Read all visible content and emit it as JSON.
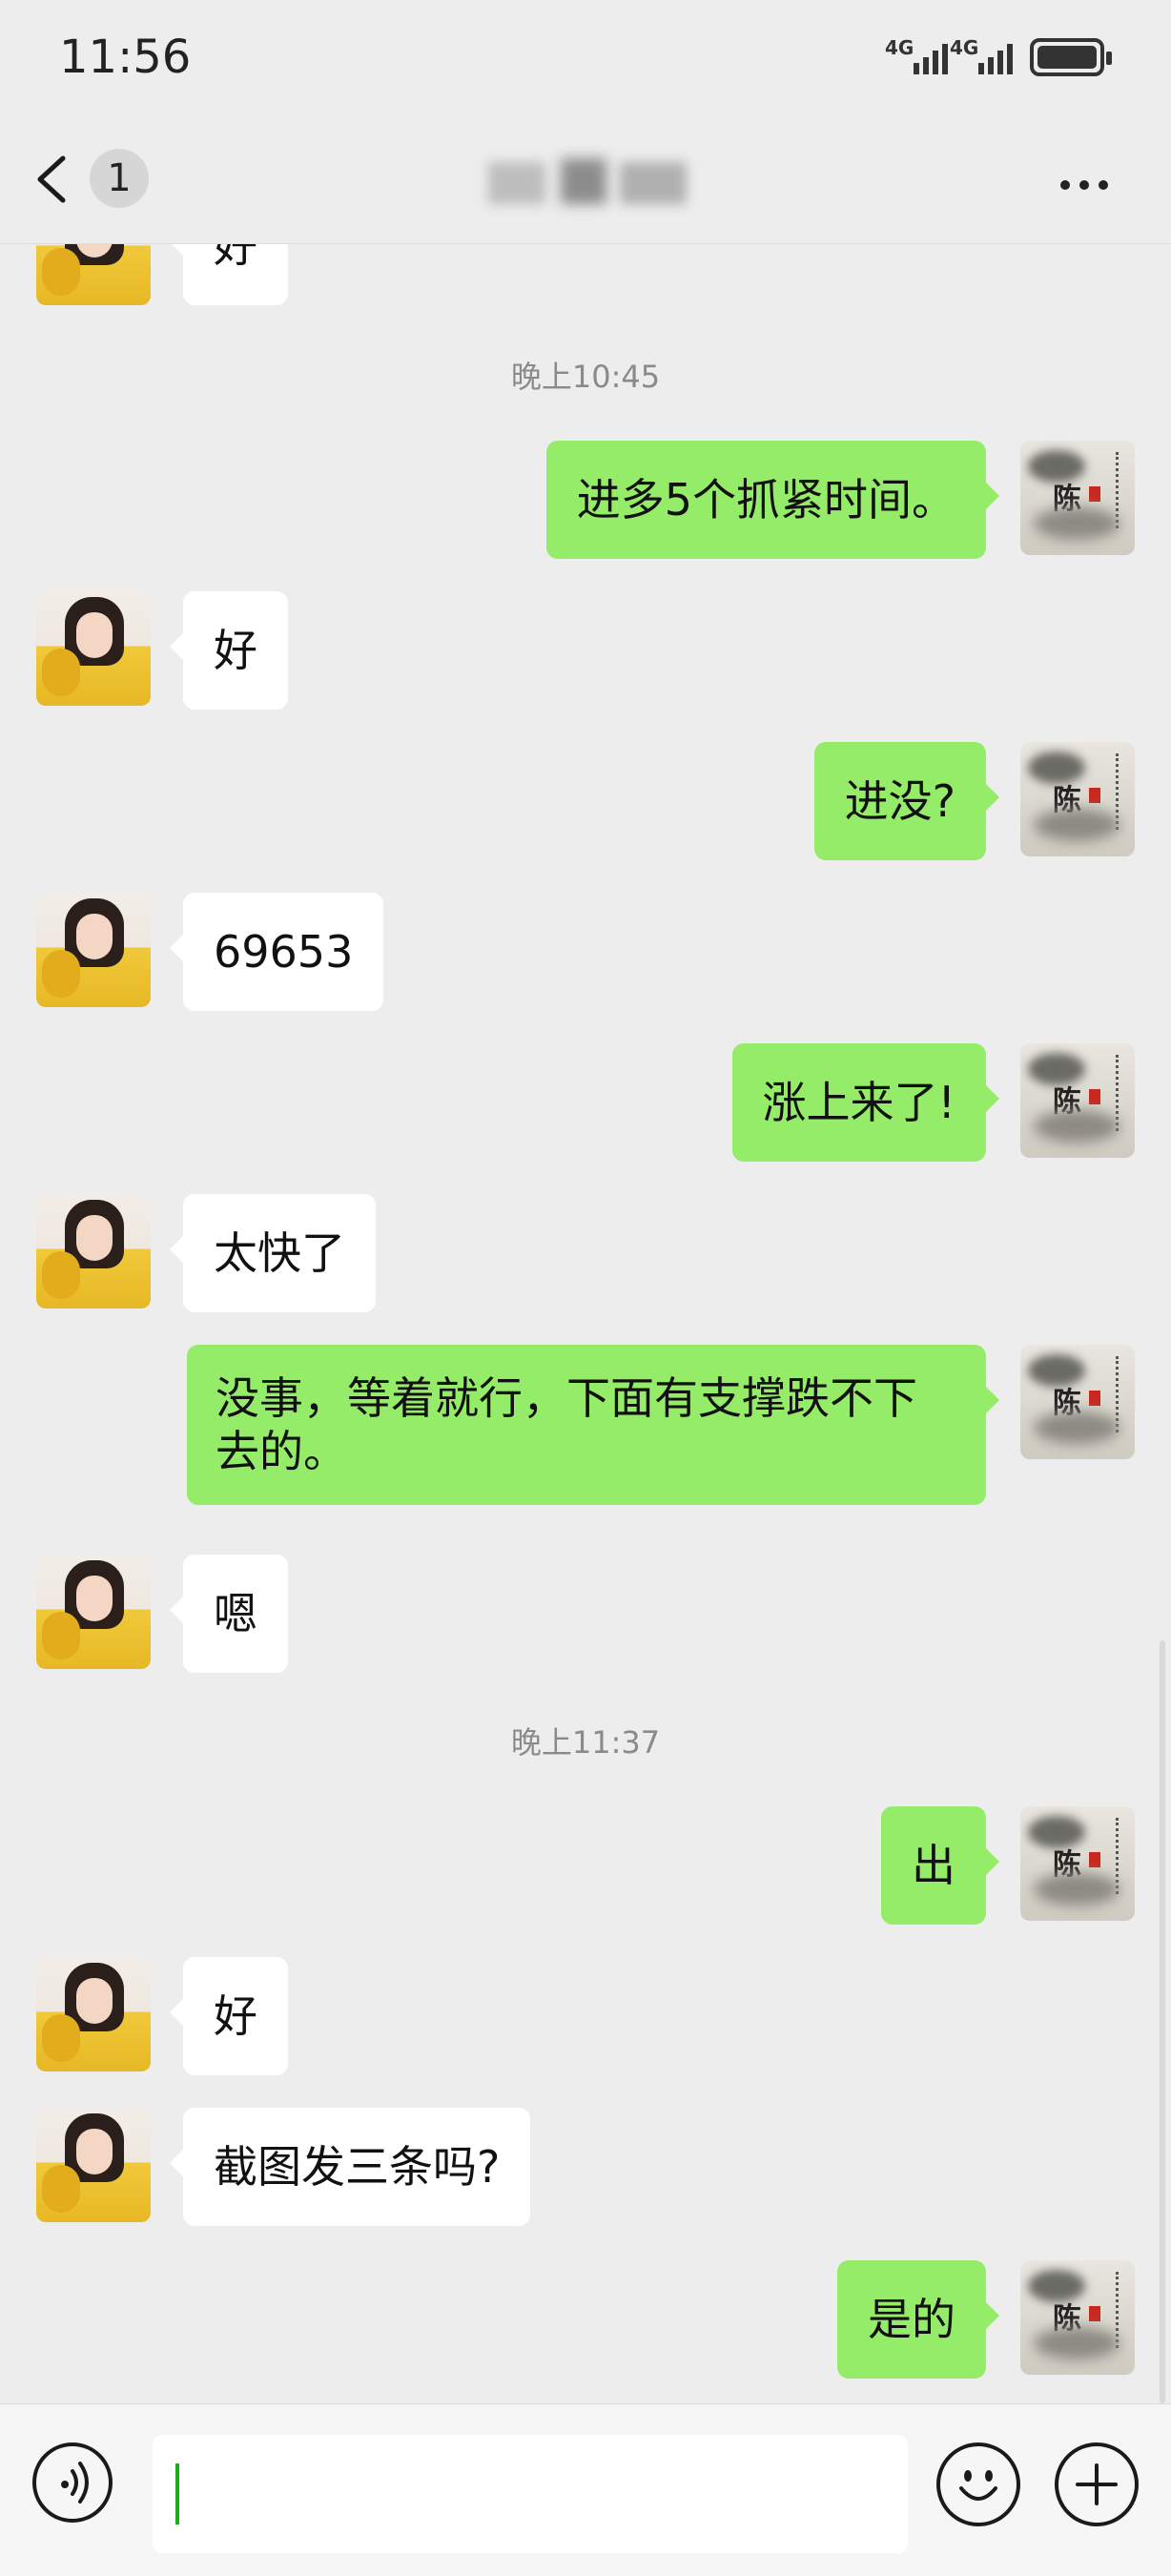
{
  "status_bar": {
    "time": "11:56",
    "network1": "4G",
    "network2": "4G"
  },
  "nav": {
    "unread_count": "1"
  },
  "messages": {
    "m0": "好",
    "ts1": "晚上10:45",
    "m1": "进多5个抓紧时间。",
    "m2": "好",
    "m3": "进没?",
    "m4": "69653",
    "m5": "涨上来了!",
    "m6": "太快了",
    "m7": "没事，等着就行，下面有支撑跌不下去的。",
    "m8": "嗯",
    "ts2": "晚上11:37",
    "m9": "出",
    "m10": "好",
    "m11": "截图发三条吗?",
    "m12": "是的"
  },
  "input": {
    "value": ""
  },
  "icons": {
    "back": "chevron-left-icon",
    "more": "more-dots-icon",
    "voice": "voice-icon",
    "emoji": "emoji-icon",
    "plus": "plus-icon"
  }
}
